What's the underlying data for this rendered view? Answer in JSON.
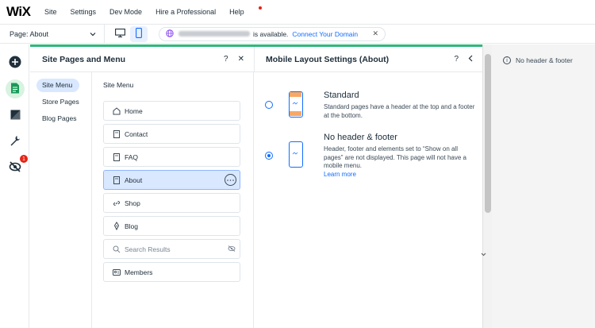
{
  "app": {
    "logo": "WiX"
  },
  "topmenu": {
    "items": [
      "Site",
      "Settings",
      "Dev Mode",
      "Hire a Professional",
      "Help"
    ]
  },
  "toolbar": {
    "page_select": "Page: About",
    "domain_available": "is available.",
    "connect_domain": "Connect Your Domain"
  },
  "rail": {
    "notification_count": "1"
  },
  "panel": {
    "title": "Site Pages and Menu",
    "tabs": [
      "Site Menu",
      "Store Pages",
      "Blog Pages"
    ],
    "menu_title": "Site Menu",
    "pages": [
      {
        "label": "Home",
        "icon": "home-icon"
      },
      {
        "label": "Contact",
        "icon": "page-icon"
      },
      {
        "label": "FAQ",
        "icon": "page-icon"
      },
      {
        "label": "About",
        "icon": "page-icon",
        "selected": true
      },
      {
        "label": "Shop",
        "icon": "link-icon"
      },
      {
        "label": "Blog",
        "icon": "pen-icon"
      },
      {
        "label": "Search Results",
        "icon": "search-icon",
        "hidden": true
      },
      {
        "label": "Members",
        "icon": "members-icon"
      }
    ]
  },
  "settings": {
    "title": "Mobile Layout Settings (About)",
    "options": [
      {
        "title": "Standard",
        "desc": "Standard pages have a header at the top and a footer at the bottom.",
        "checked": false
      },
      {
        "title": "No header & footer",
        "desc": "Header, footer and elements set to “Show on all pages” are not displayed. This page will not have a mobile menu.",
        "link": "Learn more",
        "checked": true
      }
    ]
  },
  "canvas": {
    "notice": "No header & footer"
  },
  "colors": {
    "accent": "#116dff",
    "green": "#2eb87a",
    "selected_bg": "#d9e8ff"
  }
}
